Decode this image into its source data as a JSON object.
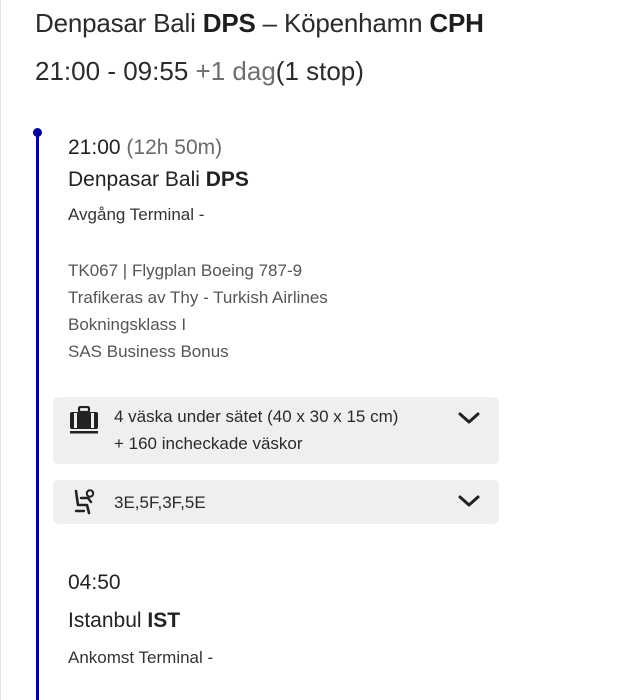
{
  "header": {
    "origin_city": "Denpasar Bali",
    "origin_code": "DPS",
    "separator": "–",
    "destination_city": "Köpenhamn",
    "destination_code": "CPH",
    "departure_time": "21:00",
    "time_separator": "-",
    "arrival_time": "09:55",
    "day_offset": "+1 dag",
    "stops": "(1 stop)"
  },
  "segment": {
    "departure": {
      "time": "21:00",
      "duration": "(12h 50m)",
      "city": "Denpasar Bali",
      "code": "DPS",
      "terminal": "Avgång Terminal -"
    },
    "flight": {
      "number_aircraft": "TK067 | Flygplan Boeing 787-9",
      "operated_by": "Trafikeras av Thy - Turkish Airlines",
      "booking_class": "Bokningsklass I",
      "bonus": "SAS Business Bonus"
    },
    "baggage": {
      "icon": "suitcase-icon",
      "line1": "4 väska under sätet (40 x 30 x 15 cm)",
      "line2": "+ 160 incheckade väskor"
    },
    "seats": {
      "icon": "seat-icon",
      "value": "3E,5F,3F,5E"
    },
    "arrival": {
      "time": "04:50",
      "city": "Istanbul",
      "code": "IST",
      "terminal": "Ankomst Terminal -"
    }
  },
  "colors": {
    "timeline": "#000099",
    "card_bg": "#efefef"
  }
}
